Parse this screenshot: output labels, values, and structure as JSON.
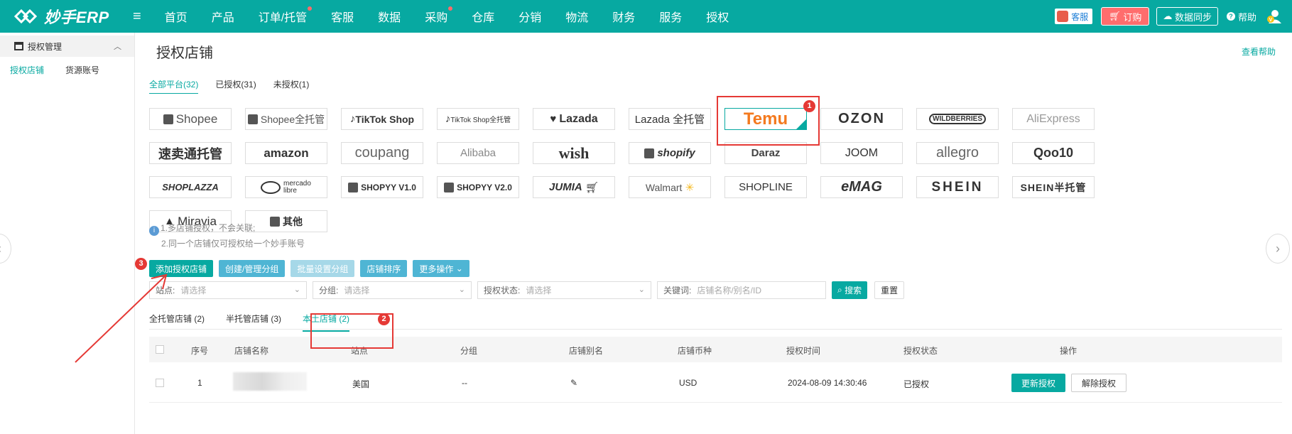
{
  "app": {
    "logo_text": "妙手ERP",
    "nav": [
      {
        "label": "首页",
        "dot": false
      },
      {
        "label": "产品",
        "dot": false
      },
      {
        "label": "订单/托管",
        "dot": true
      },
      {
        "label": "客服",
        "dot": false
      },
      {
        "label": "数据",
        "dot": false
      },
      {
        "label": "采购",
        "dot": true
      },
      {
        "label": "仓库",
        "dot": false
      },
      {
        "label": "分销",
        "dot": false
      },
      {
        "label": "物流",
        "dot": false
      },
      {
        "label": "财务",
        "dot": false
      },
      {
        "label": "服务",
        "dot": false
      },
      {
        "label": "授权",
        "dot": false
      }
    ],
    "kefu_label": "客服",
    "order_label": "订购",
    "sync_label": "数据同步",
    "help_label": "帮助",
    "accent": "#07a9a1"
  },
  "sidebar": {
    "group_label": "授权管理",
    "links": [
      "授权店铺",
      "货源账号"
    ]
  },
  "page": {
    "title": "授权店铺",
    "help_link": "查看帮助",
    "platform_tabs": [
      "全部平台(32)",
      "已授权(31)",
      "未授权(1)"
    ],
    "platforms": [
      "Shopee",
      "Shopee全托管",
      "TikTok Shop",
      "TikTok Shop全托管",
      "Lazada",
      "Lazada 全托管",
      "Temu",
      "OZON",
      "WILDBERRIES",
      "AliExpress",
      "速卖通托管",
      "amazon",
      "coupang",
      "Alibaba",
      "wish",
      "shopify",
      "Daraz",
      "JOOM",
      "allegro",
      "Qoo10",
      "SHOPLAZZA",
      "mercado libre",
      "SHOPYY V1.0",
      "SHOPYY V2.0",
      "JUMIA",
      "Walmart",
      "SHOPLINE",
      "eMAG",
      "SHEIN",
      "SHEIN半托管",
      "Miravia",
      "其他"
    ],
    "notes": [
      "1.多店铺授权，不会关联;",
      "2.同一个店铺仅可授权给一个妙手账号"
    ],
    "actions": [
      "添加授权店铺",
      "创建/管理分组",
      "批量设置分组",
      "店铺排序",
      "更多操作"
    ],
    "filters": {
      "site_label": "站点:",
      "site_ph": "请选择",
      "group_label": "分组:",
      "group_ph": "请选择",
      "status_label": "授权状态:",
      "status_ph": "请选择",
      "keyword_label": "关键词:",
      "keyword_ph": "店铺名称/别名/ID",
      "search": "搜索",
      "reset": "重置"
    },
    "store_tabs": [
      "全托管店铺 (2)",
      "半托管店铺 (3)",
      "本土店铺 (2)"
    ],
    "table": {
      "headers": [
        "序号",
        "店铺名称",
        "站点",
        "分组",
        "店铺别名",
        "店铺币种",
        "授权时间",
        "授权状态",
        "操作"
      ],
      "rows": [
        {
          "index": "1",
          "site": "美国",
          "group": "--",
          "currency": "USD",
          "time": "2024-08-09 14:30:46",
          "status": "已授权",
          "renew": "更新授权",
          "revoke": "解除授权"
        }
      ]
    }
  },
  "annotations": [
    "1",
    "2",
    "3"
  ]
}
